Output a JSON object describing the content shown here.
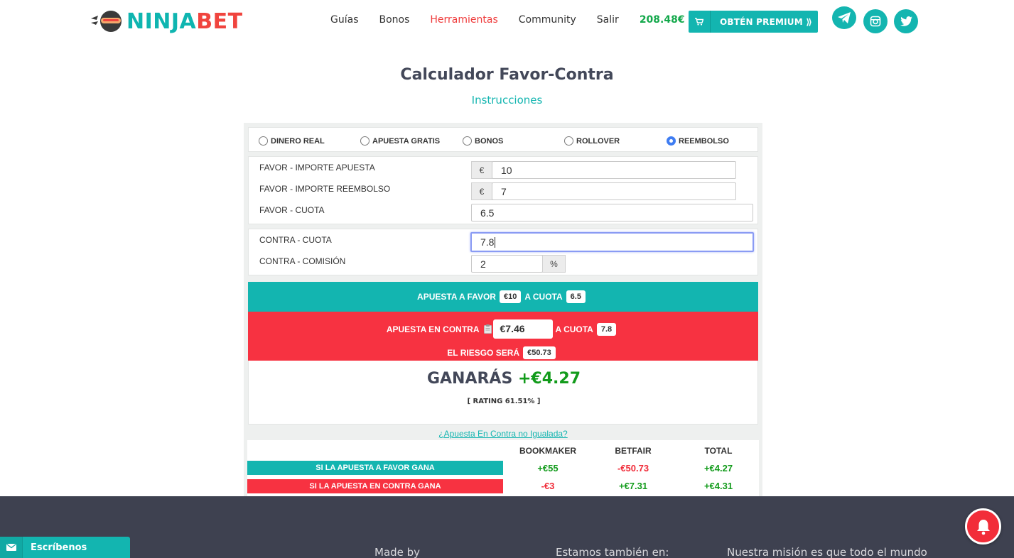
{
  "header": {
    "logo": {
      "ninja": "NINJA",
      "bet": "BET"
    },
    "nav": [
      "Guías",
      "Bonos",
      "Herramientas",
      "Community",
      "Salir"
    ],
    "active_nav": "Herramientas",
    "balance": "208.48€",
    "premium_label": "OBTÉN PREMIUM ⟫",
    "social_icons": [
      "telegram-icon",
      "instagram-icon",
      "twitter-icon"
    ]
  },
  "title": "Calculador Favor-Contra",
  "instructions": "Instrucciones",
  "mode_options": [
    {
      "label": "DINERO REAL",
      "checked": false
    },
    {
      "label": "APUESTA GRATIS",
      "checked": false
    },
    {
      "label": "BONOS",
      "checked": false
    },
    {
      "label": "ROLLOVER",
      "checked": false
    },
    {
      "label": "REEMBOLSO",
      "checked": true
    }
  ],
  "favor": {
    "stake_label": "FAVOR - IMPORTE APUESTA",
    "stake_currency": "€",
    "stake_value": "10",
    "refund_label": "FAVOR - IMPORTE REEMBOLSO",
    "refund_currency": "€",
    "refund_value": "7",
    "odds_label": "FAVOR - CUOTA",
    "odds_value": "6.5"
  },
  "contra": {
    "odds_label": "CONTRA - CUOTA",
    "odds_value": "7.8",
    "commission_label": "CONTRA - COMISIÓN",
    "commission_value": "2",
    "commission_unit": "%"
  },
  "summary": {
    "favor_prefix": "APUESTA A FAVOR",
    "favor_stake": "€10",
    "favor_mid": "A CUOTA",
    "favor_odds": "6.5",
    "contra_prefix": "APUESTA EN CONTRA",
    "contra_stake": "€7.46",
    "contra_mid": "A CUOTA",
    "contra_odds": "7.8",
    "risk_prefix": "EL RIESGO SERÁ",
    "risk_value": "€50.73",
    "win_prefix": "GANARÁS",
    "win_value": "+€4.27",
    "rating": "[ RATING 61.51% ]"
  },
  "unmatched_link": "¿Apuesta En Contra no Igualada?",
  "outcome_table": {
    "headers": [
      "BOOKMAKER",
      "BETFAIR",
      "TOTAL"
    ],
    "rows": [
      {
        "label": "SI LA APUESTA A FAVOR GANA",
        "color": "#13b5b0",
        "values": [
          "+€55",
          "-€50.73",
          "+€4.27"
        ]
      },
      {
        "label": "SI LA APUESTA EN CONTRA GANA",
        "color": "#f73241",
        "values": [
          "-€3",
          "+€7.31",
          "+€4.31"
        ]
      }
    ]
  },
  "footer": {
    "col1": "Made by",
    "col2": "Estamos también en:",
    "col3": "Nuestra misión es que todo el mundo"
  },
  "chat": {
    "label": "Escríbenos"
  },
  "colors": {
    "teal": "#13b5b0",
    "red": "#f73241",
    "green": "#129b1b",
    "footer_bg": "#3e4150"
  }
}
